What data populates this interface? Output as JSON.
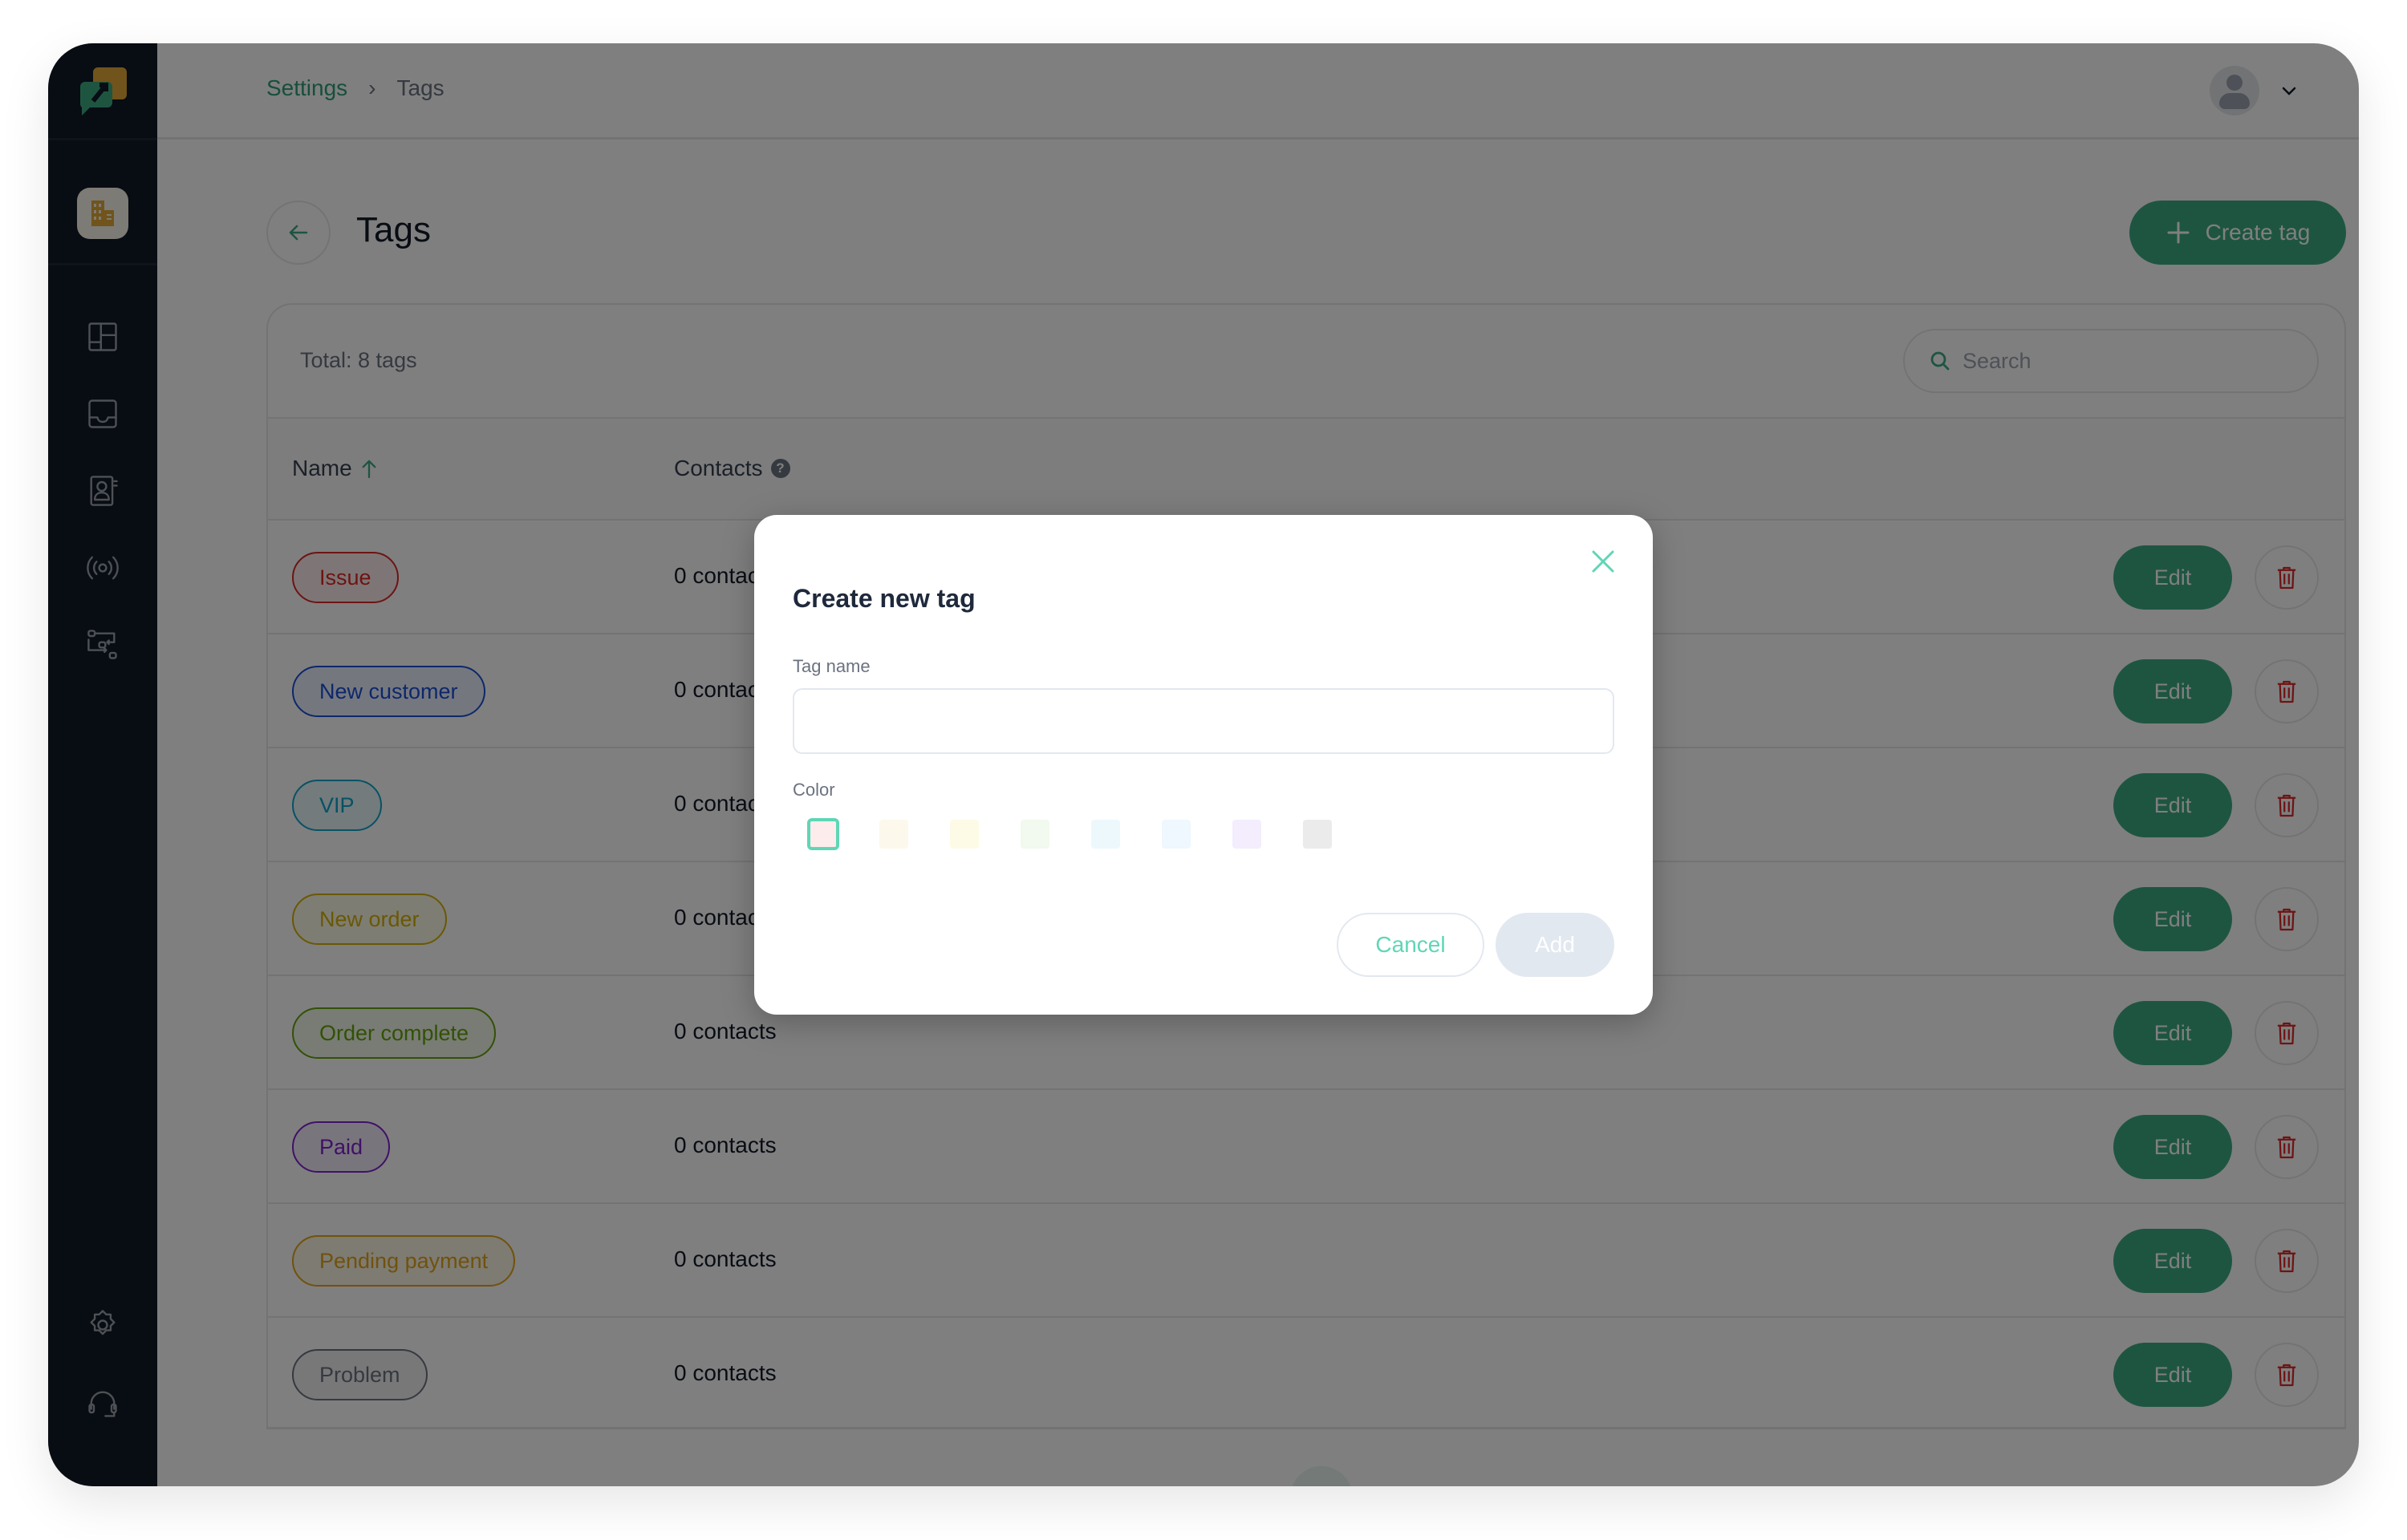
{
  "breadcrumb": {
    "parent": "Settings",
    "separator": "›",
    "current": "Tags"
  },
  "page": {
    "title": "Tags",
    "create_label": "Create tag"
  },
  "table": {
    "total_label": "Total: 8 tags",
    "search_placeholder": "Search",
    "columns": {
      "name": "Name",
      "contacts": "Contacts"
    },
    "sort": "ascending",
    "edit_label": "Edit",
    "rows": [
      {
        "name": "Issue",
        "contacts": "0 contacts",
        "color": "#dc2626",
        "bg": "#fdecec"
      },
      {
        "name": "New customer",
        "contacts": "0 contacts",
        "color": "#1d4ed8",
        "bg": "#e8f0fd"
      },
      {
        "name": "VIP",
        "contacts": "0 contacts",
        "color": "#0ea5c9",
        "bg": "#e6f7fb"
      },
      {
        "name": "New order",
        "contacts": "0 contacts",
        "color": "#d4b106",
        "bg": "#fdfae6"
      },
      {
        "name": "Order complete",
        "contacts": "0 contacts",
        "color": "#65a30d",
        "bg": "#f1f8e9"
      },
      {
        "name": "Paid",
        "contacts": "0 contacts",
        "color": "#7e22ce",
        "bg": "#f3ebfb"
      },
      {
        "name": "Pending payment",
        "contacts": "0 contacts",
        "color": "#e0a41a",
        "bg": "#fdf6e4"
      },
      {
        "name": "Problem",
        "contacts": "0 contacts",
        "color": "#6b7280",
        "bg": "#f1f1f1"
      }
    ]
  },
  "modal": {
    "title": "Create new tag",
    "tag_name_label": "Tag name",
    "tag_name_value": "",
    "tag_name_placeholder": "",
    "color_label": "Color",
    "colors": [
      "#fcecec",
      "#fdf8ec",
      "#fdfbe6",
      "#f2f9ee",
      "#edf8fd",
      "#eef8fe",
      "#f3edfd",
      "#ebebeb"
    ],
    "selected_color_index": 0,
    "cancel_label": "Cancel",
    "add_label": "Add"
  },
  "sidebar": {
    "items": [
      {
        "icon": "dashboard-icon"
      },
      {
        "icon": "inbox-icon"
      },
      {
        "icon": "contacts-icon"
      },
      {
        "icon": "broadcast-icon"
      },
      {
        "icon": "workflow-icon"
      }
    ],
    "bottom": [
      {
        "icon": "gear-icon"
      },
      {
        "icon": "headset-icon"
      }
    ]
  }
}
